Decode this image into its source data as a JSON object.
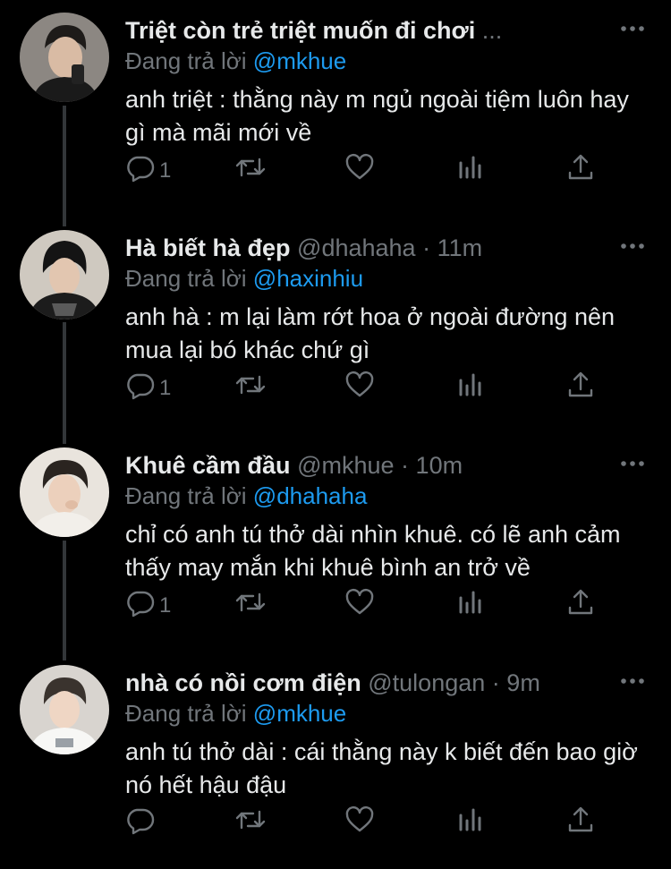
{
  "reply_prefix": "Đang trả lời",
  "tweets": [
    {
      "display_name": "Triệt còn trẻ triệt muốn đi chơi",
      "handle": "",
      "time": "",
      "truncation": "...",
      "reply_to": "@mkhue",
      "text": "anh triệt : thằng này m ngủ ngoài tiệm luôn hay gì mà mãi mới về",
      "reply_count": "1"
    },
    {
      "display_name": "Hà biết hà đẹp",
      "handle": "@dhahaha",
      "time": "11m",
      "truncation": "",
      "reply_to": "@haxinhiu",
      "text": "anh hà : m lại làm rớt hoa ở ngoài đường nên mua lại bó khác chứ gì",
      "reply_count": "1"
    },
    {
      "display_name": "Khuê cầm đầu",
      "handle": "@mkhue",
      "time": "10m",
      "truncation": "",
      "reply_to": "@dhahaha",
      "text": "chỉ có anh tú thở dài nhìn khuê. có lẽ anh cảm thấy may mắn khi khuê bình an trở về",
      "reply_count": "1"
    },
    {
      "display_name": "nhà có nồi cơm điện",
      "handle": "@tulongan",
      "time": "9m",
      "truncation": "",
      "reply_to": "@mkhue",
      "text": "anh tú thở dài : cái thằng này k biết đến bao giờ nó hết hậu đậu",
      "reply_count": ""
    }
  ],
  "icons": {
    "reply": "reply-bubble-icon",
    "retweet": "retweet-icon",
    "like": "heart-icon",
    "views": "views-bar-icon",
    "share": "share-upload-icon",
    "more": "more-dots-icon"
  },
  "colors": {
    "background": "#000000",
    "text": "#e7e9ea",
    "secondary": "#71767b",
    "link": "#1d9bf0",
    "thread_line": "#333639"
  }
}
